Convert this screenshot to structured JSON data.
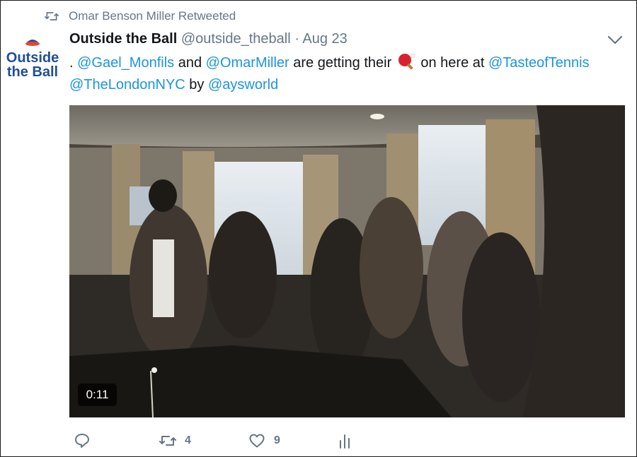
{
  "context": {
    "icon": "retweet-icon",
    "text": "Omar Benson Miller Retweeted"
  },
  "avatar": {
    "line1": "Outside",
    "line2": "the Ball"
  },
  "tweet": {
    "name": "Outside the Ball",
    "handle": "@outside_theball",
    "separator": "·",
    "date": "Aug 23",
    "text_prefix": ". ",
    "mention1": "@Gael_Monfils",
    "and": " and ",
    "mention2": "@OmarMiller",
    "are_getting": " are getting their ",
    "emoji": "ping-pong-emoji",
    "on_here": " on here at ",
    "mention3": "@TasteofTennis",
    "mention4": "@TheLondonNYC",
    "by": " by ",
    "mention5": "@aysworld"
  },
  "media": {
    "duration": "0:11"
  },
  "actions": {
    "reply_icon": "reply-icon",
    "retweet_icon": "retweet-icon",
    "retweet_count": "4",
    "like_icon": "heart-icon",
    "like_count": "9",
    "analytics_icon": "analytics-icon"
  },
  "colors": {
    "link": "#1b95e0",
    "muted": "#657786",
    "text": "#14171a"
  }
}
